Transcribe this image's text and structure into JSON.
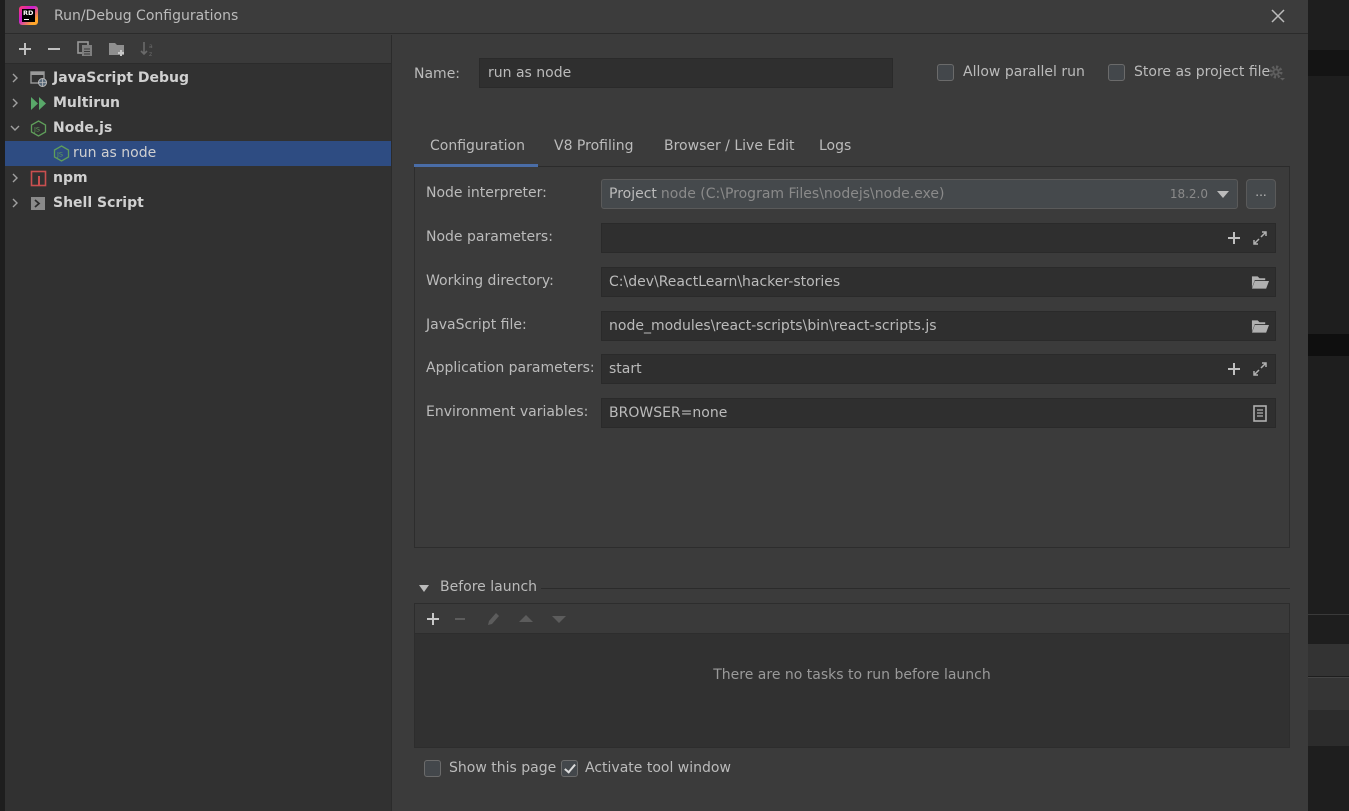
{
  "window": {
    "title": "Run/Debug Configurations",
    "app_logo_text": "RD"
  },
  "left_toolbar": {
    "buttons": [
      {
        "name": "add",
        "icon": "plus-icon"
      },
      {
        "name": "remove",
        "icon": "minus-icon"
      },
      {
        "name": "copy",
        "icon": "copy-icon"
      },
      {
        "name": "new-folder",
        "icon": "folder-add-icon"
      },
      {
        "name": "sort",
        "icon": "sort-alpha-icon"
      }
    ]
  },
  "tree": {
    "items": [
      {
        "label": "JavaScript Debug",
        "icon": "js-debug-icon",
        "expanded": false,
        "level": 0
      },
      {
        "label": "Multirun",
        "icon": "multirun-icon",
        "expanded": false,
        "level": 0
      },
      {
        "label": "Node.js",
        "icon": "nodejs-icon",
        "expanded": true,
        "level": 0
      },
      {
        "label": "run as node",
        "icon": "nodejs-icon",
        "level": 1,
        "selected": true
      },
      {
        "label": "npm",
        "icon": "npm-icon",
        "expanded": false,
        "level": 0
      },
      {
        "label": "Shell Script",
        "icon": "shell-script-icon",
        "expanded": false,
        "level": 0
      }
    ]
  },
  "config": {
    "name_label": "Name:",
    "name_value": "run as node",
    "allow_parallel_label": "Allow parallel run",
    "allow_parallel_checked": false,
    "store_project_label": "Store as project file",
    "store_project_checked": false
  },
  "tabs": [
    {
      "label": "Configuration",
      "active": true
    },
    {
      "label": "V8 Profiling",
      "active": false
    },
    {
      "label": "Browser / Live Edit",
      "active": false
    },
    {
      "label": "Logs",
      "active": false
    }
  ],
  "form": {
    "node_interpreter": {
      "label": "Node interpreter:",
      "prefix": "Project",
      "value": "node (C:\\Program Files\\nodejs\\node.exe)",
      "version": "18.2.0",
      "ellipsis": "..."
    },
    "node_parameters": {
      "label": "Node parameters:",
      "value": ""
    },
    "working_directory": {
      "label": "Working directory:",
      "value": "C:\\dev\\ReactLearn\\hacker-stories"
    },
    "javascript_file": {
      "label": "JavaScript file:",
      "value": "node_modules\\react-scripts\\bin\\react-scripts.js"
    },
    "application_parameters": {
      "label": "Application parameters:",
      "value": "start"
    },
    "environment_variables": {
      "label": "Environment variables:",
      "value": "BROWSER=none"
    }
  },
  "before_launch": {
    "title": "Before launch",
    "empty_text": "There are no tasks to run before launch",
    "toolbar": [
      {
        "name": "add",
        "icon": "plus-icon",
        "enabled": true
      },
      {
        "name": "remove",
        "icon": "minus-icon",
        "enabled": false
      },
      {
        "name": "edit",
        "icon": "pencil-icon",
        "enabled": false
      },
      {
        "name": "move-up",
        "icon": "arrow-up-icon",
        "enabled": false
      },
      {
        "name": "move-down",
        "icon": "arrow-down-icon",
        "enabled": false
      }
    ]
  },
  "footer": {
    "show_page_label": "Show this page",
    "show_page_checked": false,
    "activate_tool_label": "Activate tool window",
    "activate_tool_checked": true
  },
  "colors": {
    "selection": "#2e4c82",
    "tab_underline": "#4a6da7",
    "nodejs_green": "#5f9e5a",
    "multirun_green": "#59a869",
    "npm_red": "#c94f4f"
  }
}
